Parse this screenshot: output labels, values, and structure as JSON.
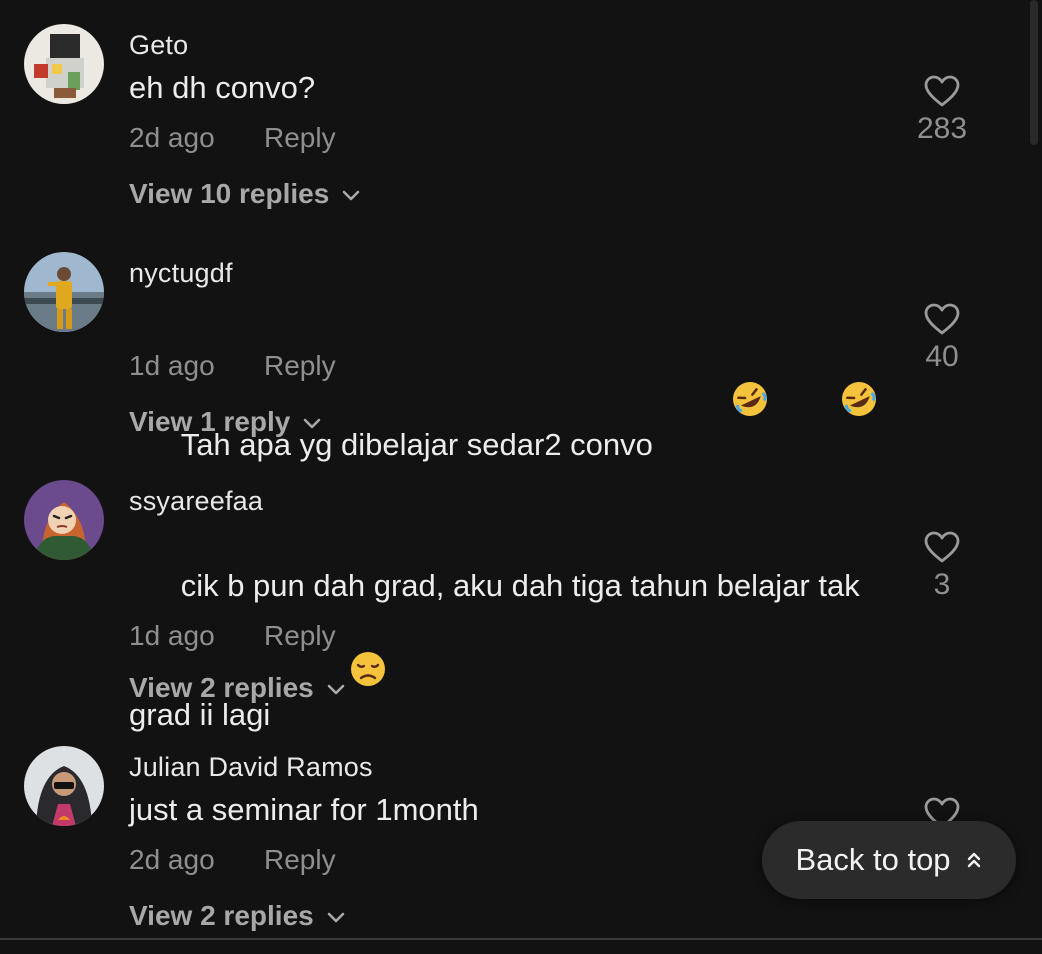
{
  "comments": [
    {
      "username": "Geto",
      "text": "eh dh convo?",
      "time": "2d ago",
      "reply_label": "Reply",
      "view_replies": "View 10 replies",
      "likes": "283",
      "avatar_colors": [
        "#e8e4df",
        "#c23a2a",
        "#333333"
      ]
    },
    {
      "username": "nyctugdf",
      "text": "Tah apa yg dibelajar sedar2 convo ",
      "emojis": [
        "rolling-on-floor-laughing",
        "rolling-on-floor-laughing"
      ],
      "time": "1d ago",
      "reply_label": "Reply",
      "view_replies": "View 1 reply",
      "likes": "40",
      "avatar_colors": [
        "#9bb3c9",
        "#d7a21e",
        "#4a5a66"
      ]
    },
    {
      "username": "ssyareefaa",
      "text": "cik b pun dah grad, aku dah tiga tahun belajar tak grad ii lagi ",
      "emojis": [
        "disappointed-face"
      ],
      "time": "1d ago",
      "reply_label": "Reply",
      "view_replies": "View 2 replies",
      "likes": "3",
      "avatar_colors": [
        "#6a4a8a",
        "#c86a3a",
        "#2f5a34"
      ]
    },
    {
      "username": "Julian David Ramos",
      "text": "just a seminar for 1month",
      "time": "2d ago",
      "reply_label": "Reply",
      "view_replies": "View 2 replies",
      "likes": "",
      "avatar_colors": [
        "#d9dde0",
        "#222222",
        "#c23a6a"
      ]
    }
  ],
  "back_to_top": {
    "label": "Back to top",
    "icon": "double-chevron-up-icon"
  },
  "colors": {
    "background": "#121212",
    "primary_text": "#ececec",
    "secondary_text": "#8f8f8f",
    "button_bg": "#2b2b2b"
  }
}
